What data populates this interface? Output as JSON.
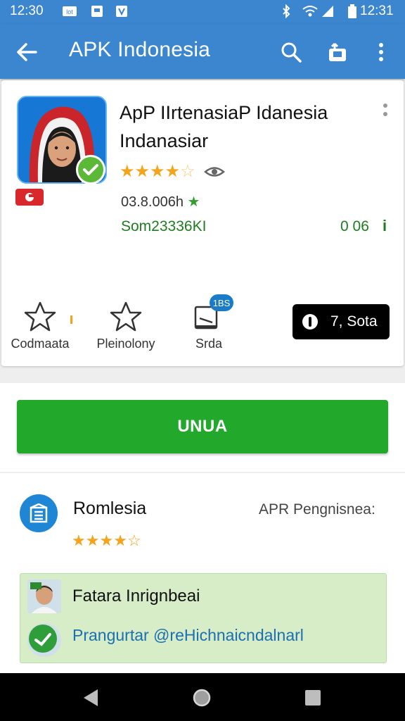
{
  "status_bar": {
    "time_left": "12:30",
    "time_right": "12:31",
    "icon_names": [
      "lock-tag-icon",
      "image-icon",
      "shield-icon",
      "bluetooth-icon",
      "wifi-icon",
      "signal-icon",
      "battery-icon"
    ]
  },
  "app_bar": {
    "title": "APK Indonesia",
    "icon_names": [
      "back-arrow-icon",
      "search-icon",
      "share-bag-icon",
      "more-vert-icon"
    ]
  },
  "app": {
    "name_line1": "ApP IIrtenasiaP Idanesia",
    "name_line2": "Indanasiar",
    "rating_stars": 4.5,
    "meta1": "03.8.006h",
    "meta2": "Som23336KI",
    "meta3": "0 06",
    "meta3_icon": "i"
  },
  "actions": [
    {
      "label": "Codmaata",
      "icon": "star-outline-icon"
    },
    {
      "label": "Pleinolony",
      "icon": "star-outline-icon"
    },
    {
      "label": "Srda",
      "icon": "message-icon",
      "badge": "1BS"
    }
  ],
  "chip": {
    "label": "7, Sota"
  },
  "install": {
    "label": "UNUA"
  },
  "developer": {
    "name": "Romlesia",
    "right_text": "APR Pengnisnea:",
    "rating_stars": 4
  },
  "feature_box": {
    "line1": "Fatara Inrignbeai",
    "line2": "Prangurtar @reHichnaicndalnarl"
  },
  "colors": {
    "primary": "#3b86cf",
    "install_green": "#22a82a",
    "star": "#f3a41b",
    "meta_green": "#1e7d1e"
  }
}
